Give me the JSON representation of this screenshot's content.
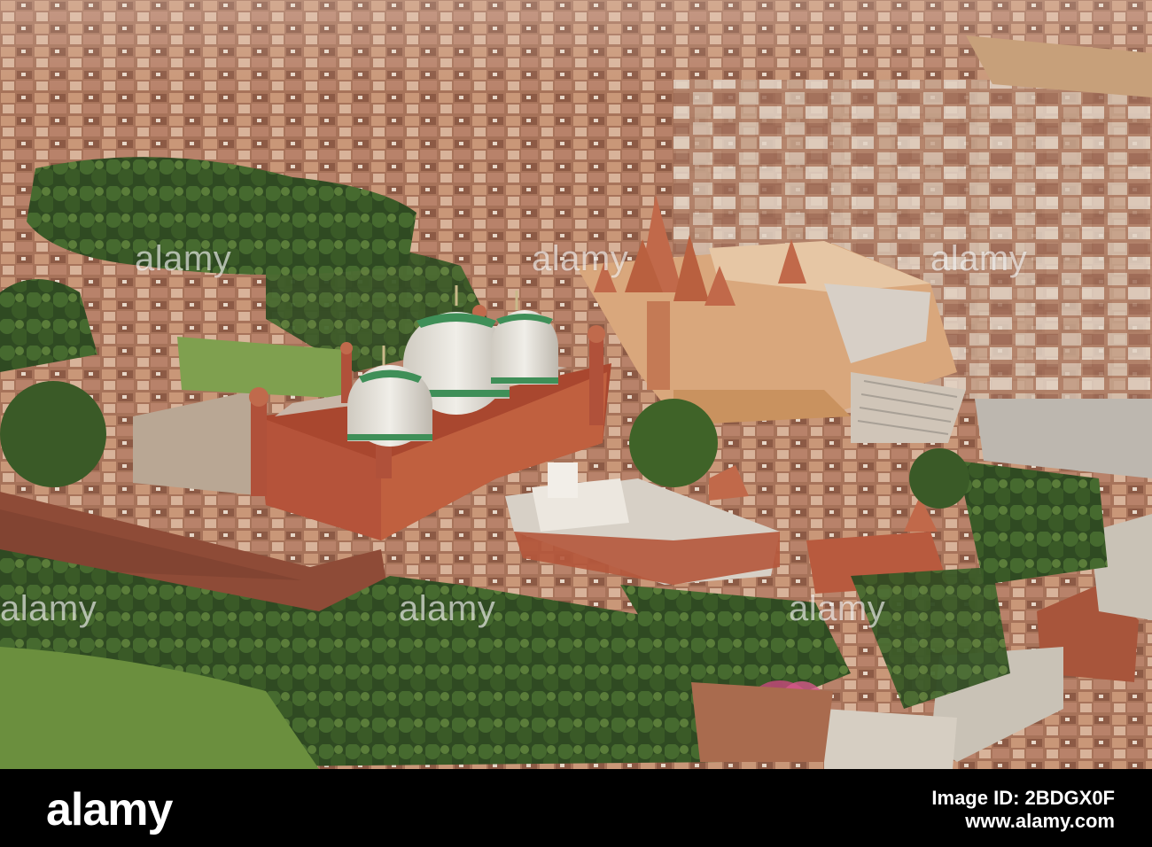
{
  "watermark": {
    "text": "alamy",
    "color": "#ffffff"
  },
  "footer": {
    "logo": "alamy",
    "image_id": "Image ID: 2BDGX0F",
    "url": "www.alamy.com",
    "background": "#000000"
  },
  "scene": {
    "icon": "aerial-photo",
    "colors": {
      "sky_haze": "#b9a48a",
      "town": "#b07a5c",
      "red_sandstone": "#b3533a",
      "dome": "#e8e6e0",
      "dome_band": "#3f8f58",
      "temple": "#d9a77c",
      "foliage": "#3b5a2a",
      "lawn": "#5f8a3a"
    }
  }
}
